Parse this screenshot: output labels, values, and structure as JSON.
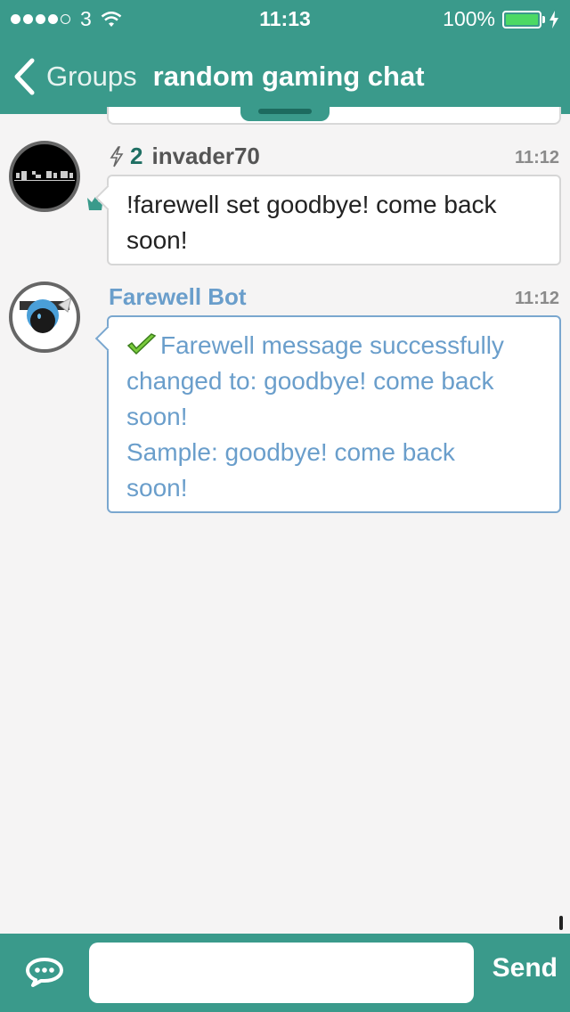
{
  "status_bar": {
    "carrier": "3",
    "time": "11:13",
    "battery": "100%"
  },
  "nav": {
    "back_label": "Groups",
    "title": "random gaming chat"
  },
  "messages": [
    {
      "karma": "2",
      "username": "invader70",
      "time": "11:12",
      "text_lines": [
        "!farewell set goodbye! come back",
        "soon!"
      ]
    },
    {
      "username": "Farewell Bot",
      "time": "11:12",
      "text_lines": [
        "Farewell message successfully",
        "changed to: goodbye! come back",
        "soon!",
        "Sample: goodbye! come back",
        "soon!"
      ]
    }
  ],
  "composer": {
    "placeholder": "",
    "send_label": "Send"
  },
  "colors": {
    "accent": "#3a9a8b",
    "bot_text": "#6a9ecb"
  }
}
